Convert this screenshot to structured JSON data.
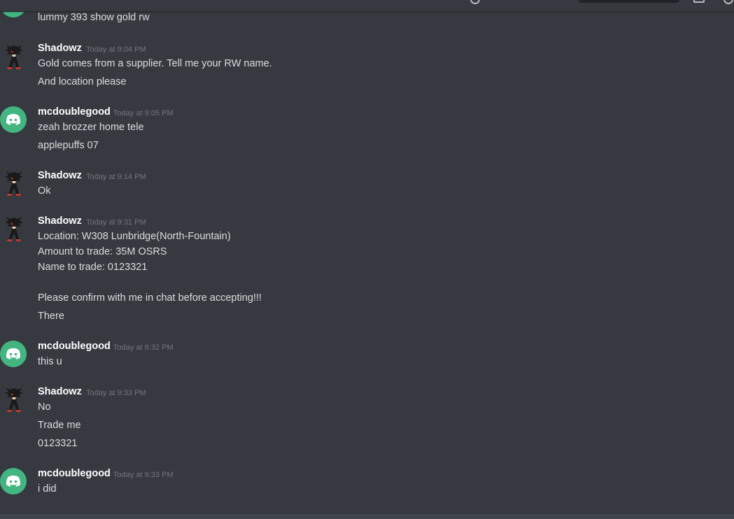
{
  "topbar": {
    "icons": [
      "help-icon",
      "search-field",
      "inbox-icon",
      "settings-icon"
    ]
  },
  "messages": [
    {
      "author": "",
      "avatar": "discord-default",
      "timestamp": "",
      "lines": [
        "lummy 393 show gold rw"
      ]
    },
    {
      "author": "Shadowz",
      "avatar": "shadow-character",
      "timestamp": "Today at 9:04 PM",
      "lines": [
        "Gold comes from a supplier. Tell me your RW name.",
        "And location please"
      ]
    },
    {
      "author": "mcdoublegood",
      "avatar": "discord-default",
      "timestamp": "Today at 9:05 PM",
      "lines": [
        "zeah brozzer home tele",
        "applepuffs 07"
      ]
    },
    {
      "author": "Shadowz",
      "avatar": "shadow-character",
      "timestamp": "Today at 9:14 PM",
      "lines": [
        "Ok"
      ]
    },
    {
      "author": "Shadowz",
      "avatar": "shadow-character",
      "timestamp": "Today at 9:31 PM",
      "lines": [
        "Location: W308 Lunbridge(North-Fountain)",
        "Amount to trade: 35M OSRS",
        "Name to trade: 0123321",
        "Please confirm with me in chat before accepting!!!",
        "There"
      ]
    },
    {
      "author": "mcdoublegood",
      "avatar": "discord-default",
      "timestamp": "Today at 9:32 PM",
      "lines": [
        "this u"
      ]
    },
    {
      "author": "Shadowz",
      "avatar": "shadow-character",
      "timestamp": "Today at 9:33 PM",
      "lines": [
        "No",
        "Trade me",
        "0123321"
      ]
    },
    {
      "author": "mcdoublegood",
      "avatar": "discord-default",
      "timestamp": "Today at 9:33 PM",
      "lines": [
        "i did"
      ]
    }
  ],
  "colors": {
    "background": "#36393f",
    "username": "#ffffff",
    "message_text": "#dcddde",
    "timestamp": "#72767d",
    "discord_avatar": "#43b581"
  }
}
